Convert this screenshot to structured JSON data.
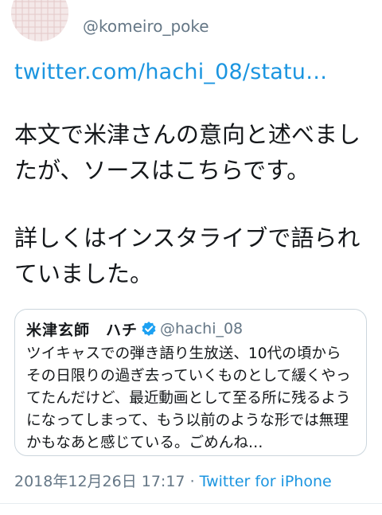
{
  "header": {
    "handle": "@komeiro_poke",
    "name_fragment": "゛"
  },
  "tweet": {
    "link_text": "twitter.com/hachi_08/statu…",
    "paragraphs": [
      "本文で米津さんの意向と述べましたが、ソースはこちらです。",
      "詳しくはインスタライブで語られていました。"
    ]
  },
  "quote": {
    "name": "米津玄師　ハチ",
    "handle": "@hachi_08",
    "text": "ツイキャスでの弾き語り生放送、10代の頃からその日限りの過ぎ去っていくものとして緩くやってたんだけど、最近動画として至る所に残るようになってしまって、もう以前のような形では無理かもなあと感じている。ごめんね…"
  },
  "meta": {
    "timestamp": "2018年12月26日 17:17",
    "separator": "·",
    "source": "Twitter for iPhone"
  },
  "icons": {
    "avatar": "avatar",
    "verified": "verified-badge-icon"
  },
  "colors": {
    "link": "#1b95e0",
    "secondary_text": "#657786",
    "border": "#ccd6dd"
  }
}
